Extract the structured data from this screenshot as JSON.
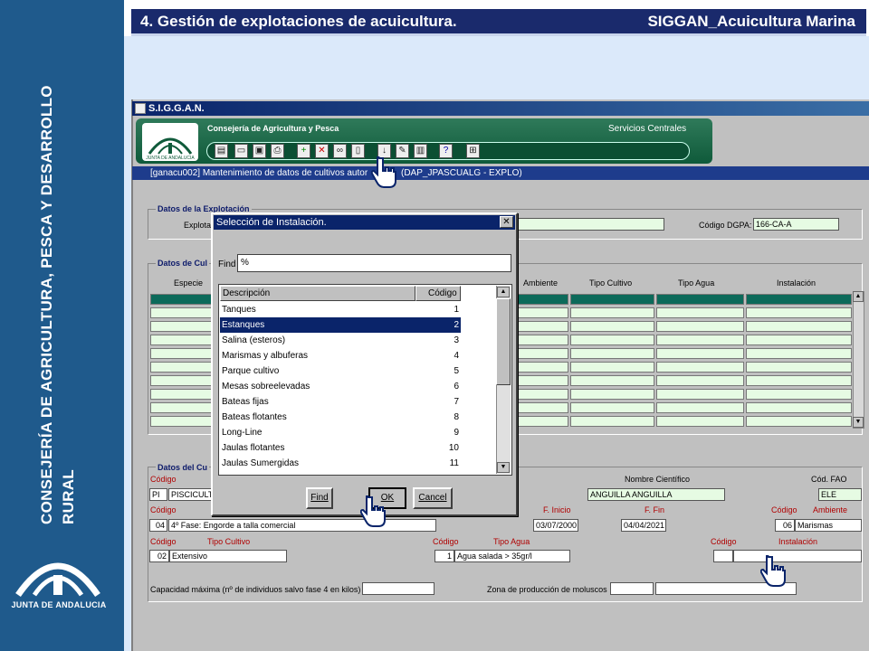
{
  "brand": {
    "vertical_text": "CONSEJERÍA DE AGRICULTURA, PESCA Y DESARROLLO RURAL",
    "logo_text": "JUNTA DE ANDALUCIA"
  },
  "slide_title": {
    "left": "4. Gestión de explotaciones de acuicultura.",
    "right": "SIGGAN_Acuicultura Marina"
  },
  "app": {
    "window_title": "S.I.G.G.A.N.",
    "header_org": "Consejería de Agricultura y Pesca",
    "header_org_right": "Servicios Centrales",
    "header_logo_text": "JUNTA DE ANDALUCIA",
    "form_title": "[ganacu002] Mantenimiento de datos de cultivos autor",
    "form_title_right": "(DAP_JPASCUALG - EXPLO)",
    "toolbar_icons": [
      "list-icon",
      "folder-icon",
      "save-icon",
      "print-icon",
      "add-icon",
      "delete-icon",
      "binoculars-icon",
      "document-icon",
      "download-icon",
      "edit-icon",
      "page-icon",
      "help-icon",
      "exit-icon"
    ]
  },
  "explotacion": {
    "group_label": "Datos de la Explotación",
    "explota_label": "Explota",
    "dgpa_label": "Código DGPA:",
    "dgpa_value": "166-CA-A"
  },
  "cultivos": {
    "group_label": "Datos de Cul",
    "columns": [
      "Especie",
      "Ambiente",
      "Tipo Cultivo",
      "Tipo Agua",
      "Instalación"
    ]
  },
  "cultivo_detail": {
    "group_label": "Datos del Cu",
    "codigo_label": "Código",
    "codigo_value": "PI",
    "especie_value": "PISCICULTU",
    "nombre_cientifico_label": "Nombre Científico",
    "nombre_cientifico_value": "ANGUILLA ANGUILLA",
    "cod_fao_label": "Cód. FAO",
    "cod_fao_value": "ELE",
    "fase_codigo_label": "Código",
    "fase_codigo": "04",
    "fase_value": "4º Fase: Engorde a talla comercial",
    "f_inicio_label": "F. Inicio",
    "f_inicio": "03/07/2000",
    "f_fin_label": "F. Fin",
    "f_fin": "04/04/2021",
    "amb_codigo_label": "Código",
    "ambiente_label": "Ambiente",
    "amb_codigo": "06",
    "ambiente_value": "Marismas",
    "tc_codigo_label": "Código",
    "tipo_cultivo_label": "Tipo Cultivo",
    "tc_codigo": "02",
    "tipo_cultivo_value": "Extensivo",
    "ta_codigo_label": "Código",
    "tipo_agua_label": "Tipo Agua",
    "ta_codigo": "1",
    "tipo_agua_value": "Agua salada > 35gr/l",
    "inst_codigo_label": "Código",
    "instalacion_label": "Instalación",
    "capacidad_label": "Capacidad máxima (nº de individuos salvo fase 4 en kilos)",
    "zona_label": "Zona de producción de moluscos"
  },
  "dialog": {
    "title": "Selección de Instalación.",
    "close": "✕",
    "find_label": "Find",
    "find_value": "%",
    "col_desc": "Descripción",
    "col_cod": "Código",
    "rows": [
      {
        "desc": "Tanques",
        "cod": "1"
      },
      {
        "desc": "Estanques",
        "cod": "2"
      },
      {
        "desc": "Salina (esteros)",
        "cod": "3"
      },
      {
        "desc": "Marismas y albuferas",
        "cod": "4"
      },
      {
        "desc": "Parque cultivo",
        "cod": "5"
      },
      {
        "desc": "Mesas sobreelevadas",
        "cod": "6"
      },
      {
        "desc": "Bateas fijas",
        "cod": "7"
      },
      {
        "desc": "Bateas flotantes",
        "cod": "8"
      },
      {
        "desc": "Long-Line",
        "cod": "9"
      },
      {
        "desc": "Jaulas flotantes",
        "cod": "10"
      },
      {
        "desc": "Jaulas Sumergidas",
        "cod": "11"
      }
    ],
    "selected_index": 1,
    "btn_find": "Find",
    "btn_ok": "OK",
    "btn_cancel": "Cancel"
  },
  "colors": {
    "brand_blue": "#1f5a8c",
    "title_navy": "#1a2a6c",
    "header_green": "#0f5a3a",
    "grid_green": "#e6fbe3",
    "selection": "#0a246a"
  }
}
